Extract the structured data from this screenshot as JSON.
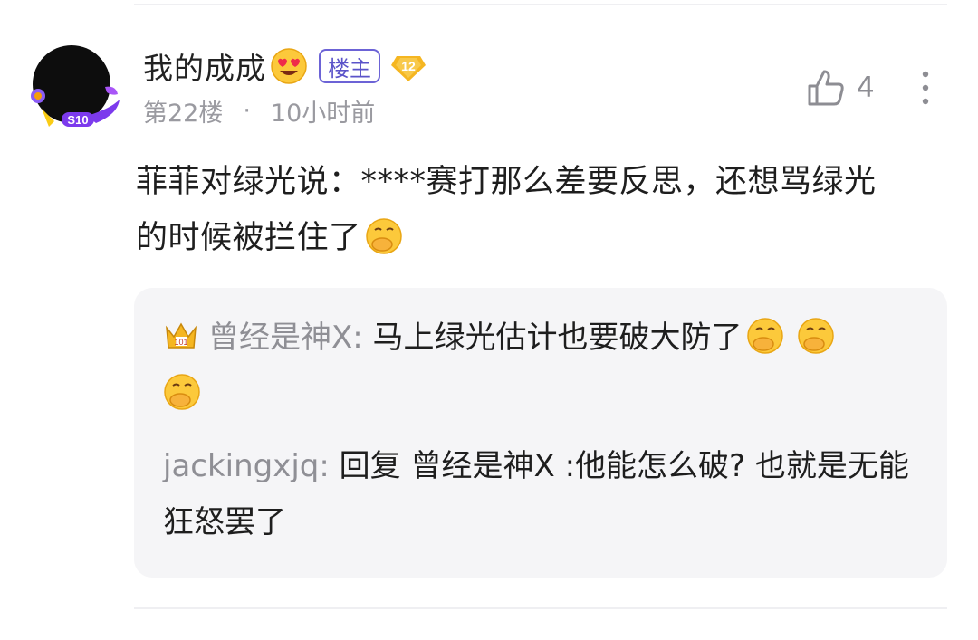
{
  "comment": {
    "username": "我的成成",
    "op_badge": "楼主",
    "level": "12",
    "floor": "第22楼",
    "separator": "·",
    "time": "10小时前",
    "likes": "4",
    "avatar_badge": "S10",
    "text_line1": "菲菲对绿光说：****赛打那么差要反思，还想骂绿光",
    "text_line2": "的时候被拦住了"
  },
  "replies": [
    {
      "user": "曾经是神X:",
      "text": " 马上绿光估计也要破大防了"
    },
    {
      "user": "jackingxjq:",
      "text": " 回复  曾经是神X :他能怎么破? 也就是无能狂怒罢了"
    }
  ],
  "icons": {
    "love_eyes": "smiling-face-with-heart-eyes-icon",
    "hand_over_mouth": "face-with-hand-over-mouth-icon",
    "crown": "crown-icon",
    "like": "thumbs-up-icon",
    "more": "more-vertical-icon"
  },
  "colors": {
    "accent": "#6c63d6",
    "level": "#f5b621",
    "muted": "#9a9aa0",
    "reply_bg": "#f5f5f7"
  }
}
